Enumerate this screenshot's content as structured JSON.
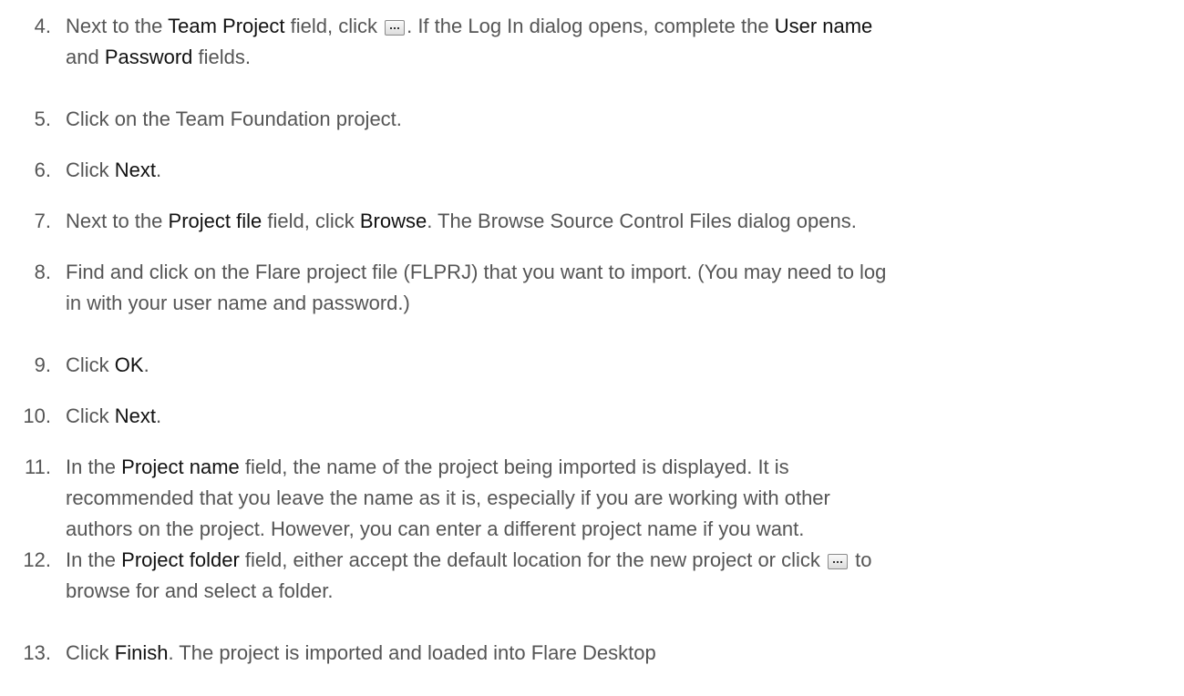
{
  "steps": [
    {
      "number": "4.",
      "lines": [
        [
          {
            "t": "Next to the "
          },
          {
            "t": "Team Project",
            "b": 1
          },
          {
            "t": " field, click "
          },
          {
            "icon": "browse-ellipsis-button-icon"
          },
          {
            "t": ". If the Log In dialog opens, complete the "
          },
          {
            "t": "User name",
            "b": 1
          }
        ],
        [
          {
            "t": "and "
          },
          {
            "t": "Password",
            "b": 1
          },
          {
            "t": " fields."
          }
        ]
      ]
    },
    {
      "number": "5.",
      "lines": [
        [
          {
            "t": "Click on the Team Foundation project."
          }
        ]
      ]
    },
    {
      "number": "6.",
      "lines": [
        [
          {
            "t": "Click "
          },
          {
            "t": "Next",
            "b": 1
          },
          {
            "t": "."
          }
        ]
      ]
    },
    {
      "number": "7.",
      "lines": [
        [
          {
            "t": "Next to the "
          },
          {
            "t": "Project file",
            "b": 1
          },
          {
            "t": " field, click "
          },
          {
            "t": "Browse",
            "b": 1
          },
          {
            "t": ". The Browse Source Control Files dialog opens."
          }
        ]
      ]
    },
    {
      "number": "8.",
      "lines": [
        [
          {
            "t": "Find and click on the Flare project file (FLPRJ) that you want to import. (You may need to log"
          }
        ],
        [
          {
            "t": "in with your user name and password.)"
          }
        ]
      ]
    },
    {
      "number": "9.",
      "lines": [
        [
          {
            "t": "Click "
          },
          {
            "t": "OK",
            "b": 1
          },
          {
            "t": "."
          }
        ]
      ]
    },
    {
      "number": "10.",
      "lines": [
        [
          {
            "t": "Click "
          },
          {
            "t": "Next",
            "b": 1
          },
          {
            "t": "."
          }
        ]
      ]
    },
    {
      "number": "11.",
      "lines": [
        [
          {
            "t": "In the "
          },
          {
            "t": "Project name",
            "b": 1
          },
          {
            "t": " field, the name of the project being imported is displayed. It is"
          }
        ],
        [
          {
            "t": "recommended that you leave the name as it is, especially if you are working with other"
          }
        ],
        [
          {
            "t": "authors on the project. However, you can enter a different project name if you want."
          }
        ]
      ]
    },
    {
      "number": "12.",
      "lines": [
        [
          {
            "t": "In the "
          },
          {
            "t": "Project folder",
            "b": 1
          },
          {
            "t": " field, either accept the default location for the new project or click "
          },
          {
            "icon": "browse-ellipsis-button-icon"
          },
          {
            "t": " to"
          }
        ],
        [
          {
            "t": "browse for and select a folder."
          }
        ]
      ]
    },
    {
      "number": "13.",
      "lines": [
        [
          {
            "t": "Click "
          },
          {
            "t": "Finish",
            "b": 1
          },
          {
            "t": ". The project is imported and loaded into Flare Desktop"
          }
        ]
      ]
    }
  ]
}
